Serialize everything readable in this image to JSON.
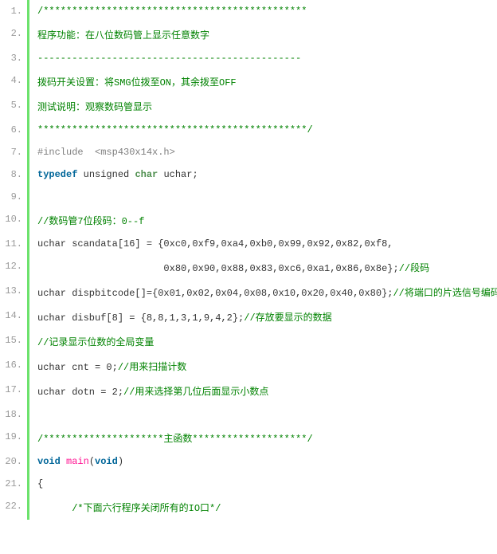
{
  "lines": [
    {
      "n": "1.",
      "spans": [
        {
          "t": "/**********************************************",
          "c": "tk-comment"
        }
      ]
    },
    {
      "n": "2.",
      "spans": [
        {
          "t": "程序功能：在八位数码管上显示任意数字",
          "c": "tk-comment"
        }
      ]
    },
    {
      "n": "3.",
      "spans": [
        {
          "t": "----------------------------------------------",
          "c": "tk-comment"
        }
      ]
    },
    {
      "n": "4.",
      "spans": [
        {
          "t": "拨码开关设置：将SMG位拨至ON，其余拨至OFF",
          "c": "tk-comment"
        }
      ]
    },
    {
      "n": "5.",
      "spans": [
        {
          "t": "测试说明：观察数码管显示",
          "c": "tk-comment"
        }
      ]
    },
    {
      "n": "6.",
      "spans": [
        {
          "t": "***********************************************/",
          "c": "tk-comment"
        }
      ]
    },
    {
      "n": "7.",
      "spans": [
        {
          "t": "#include  <msp430x14x.h>",
          "c": "tk-pp"
        }
      ]
    },
    {
      "n": "8.",
      "spans": [
        {
          "t": "typedef",
          "c": "tk-keyword"
        },
        {
          "t": " unsigned ",
          "c": "tk-plain"
        },
        {
          "t": "char",
          "c": "tk-type"
        },
        {
          "t": " uchar;",
          "c": "tk-plain"
        }
      ]
    },
    {
      "n": "9.",
      "spans": [
        {
          "t": " ",
          "c": "tk-plain"
        }
      ]
    },
    {
      "n": "10.",
      "spans": [
        {
          "t": "//数码管7位段码：0--f",
          "c": "tk-comment"
        }
      ]
    },
    {
      "n": "11.",
      "spans": [
        {
          "t": "uchar scandata[16] = {0xc0,0xf9,0xa4,0xb0,0x99,0x92,0x82,0xf8,",
          "c": "tk-plain"
        }
      ]
    },
    {
      "n": "12.",
      "spans": [
        {
          "t": "                      0x80,0x90,0x88,0x83,0xc6,0xa1,0x86,0x8e};",
          "c": "tk-plain"
        },
        {
          "t": "//段码",
          "c": "tk-comment"
        }
      ]
    },
    {
      "n": "13.",
      "spans": [
        {
          "t": "uchar dispbitcode[]={0x01,0x02,0x04,0x08,0x10,0x20,0x40,0x80};",
          "c": "tk-plain"
        },
        {
          "t": "//将端口的片选信号编码",
          "c": "tk-comment"
        }
      ]
    },
    {
      "n": "14.",
      "spans": [
        {
          "t": "uchar disbuf[8] = {8,8,1,3,1,9,4,2};",
          "c": "tk-plain"
        },
        {
          "t": "//存放要显示的数据",
          "c": "tk-comment"
        }
      ]
    },
    {
      "n": "15.",
      "spans": [
        {
          "t": "//记录显示位数的全局变量",
          "c": "tk-comment"
        }
      ]
    },
    {
      "n": "16.",
      "spans": [
        {
          "t": "uchar cnt = 0;",
          "c": "tk-plain"
        },
        {
          "t": "//用来扫描计数",
          "c": "tk-comment"
        }
      ]
    },
    {
      "n": "17.",
      "spans": [
        {
          "t": "uchar dotn = 2;",
          "c": "tk-plain"
        },
        {
          "t": "//用来选择第几位后面显示小数点",
          "c": "tk-comment"
        }
      ]
    },
    {
      "n": "18.",
      "spans": [
        {
          "t": " ",
          "c": "tk-plain"
        }
      ]
    },
    {
      "n": "19.",
      "spans": [
        {
          "t": "/*********************主函数********************/",
          "c": "tk-comment"
        }
      ]
    },
    {
      "n": "20.",
      "spans": [
        {
          "t": "void",
          "c": "tk-keyword"
        },
        {
          "t": " ",
          "c": "tk-plain"
        },
        {
          "t": "main",
          "c": "tk-func"
        },
        {
          "t": "(",
          "c": "tk-plain"
        },
        {
          "t": "void",
          "c": "tk-keyword"
        },
        {
          "t": ")",
          "c": "tk-plain"
        }
      ]
    },
    {
      "n": "21.",
      "spans": [
        {
          "t": "{",
          "c": "tk-plain"
        }
      ]
    },
    {
      "n": "22.",
      "spans": [
        {
          "t": "      ",
          "c": "tk-plain"
        },
        {
          "t": "/*下面六行程序关闭所有的IO口*/",
          "c": "tk-comment"
        }
      ]
    }
  ]
}
